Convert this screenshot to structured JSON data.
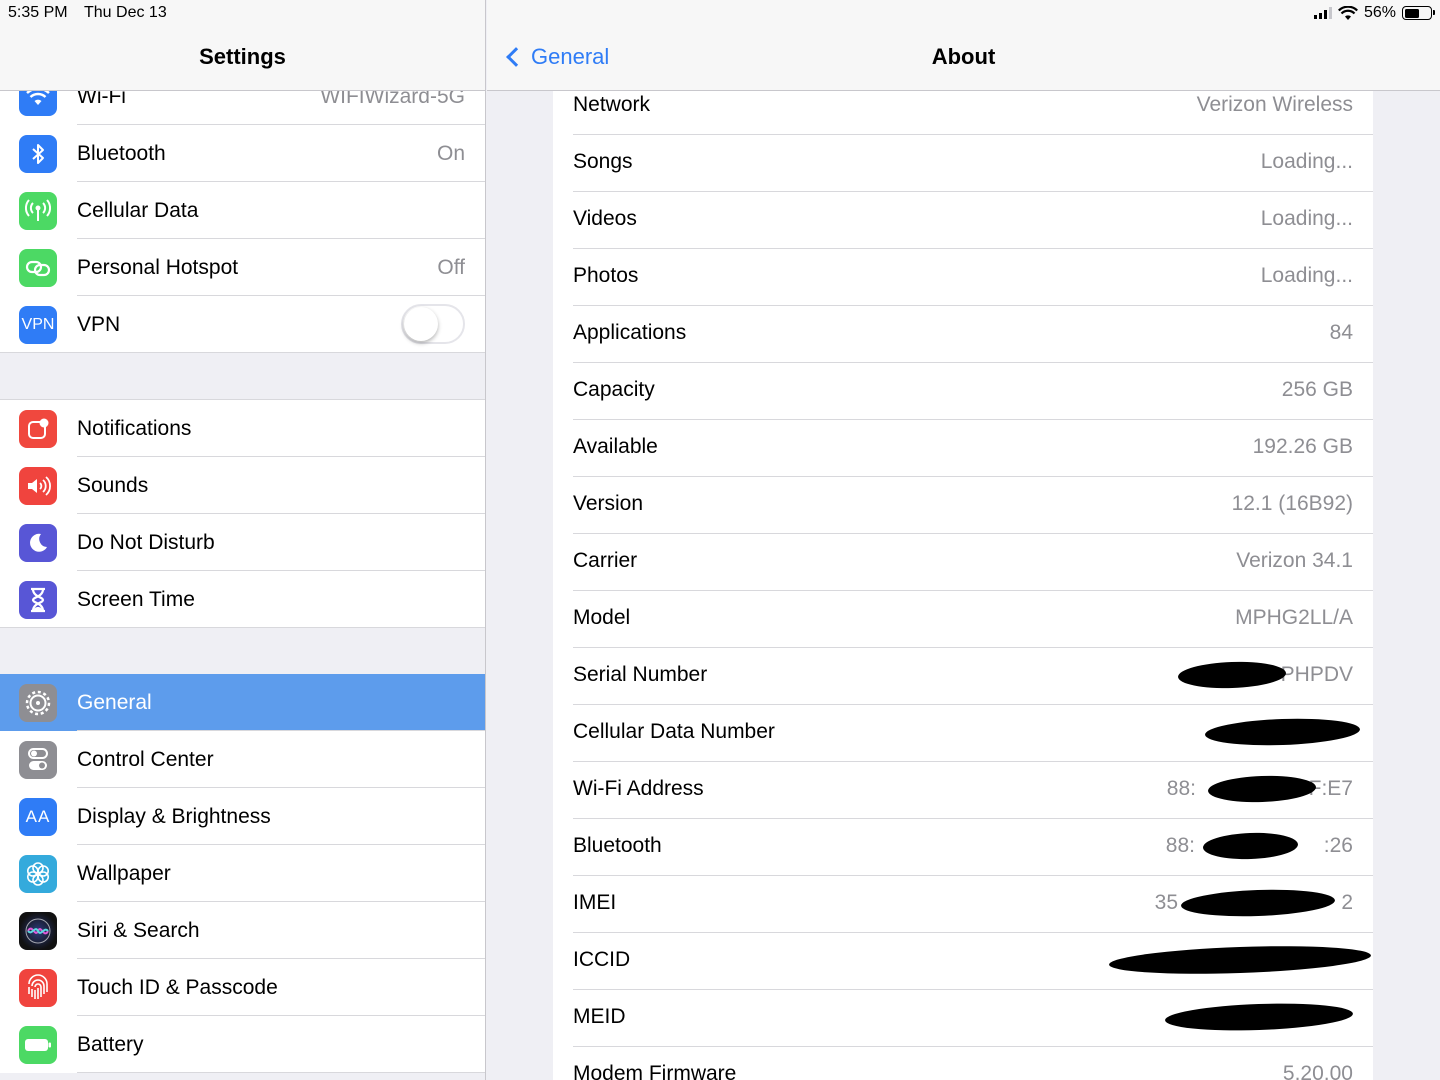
{
  "status": {
    "time": "5:35 PM",
    "date": "Thu Dec 13",
    "battery": "56%"
  },
  "master": {
    "title": "Settings",
    "groups": [
      [
        {
          "label": "Wi-Fi",
          "value": "WIFIWizard-5G",
          "icon": "wifi-icon",
          "color": "#2f7cf6"
        },
        {
          "label": "Bluetooth",
          "value": "On",
          "icon": "bluetooth-icon",
          "color": "#2f7cf6"
        },
        {
          "label": "Cellular Data",
          "value": "",
          "icon": "antenna-icon",
          "color": "#4cd964"
        },
        {
          "label": "Personal Hotspot",
          "value": "Off",
          "icon": "link-icon",
          "color": "#4cd964"
        },
        {
          "label": "VPN",
          "value": "",
          "icon": "vpn-icon",
          "color": "#2f7cf6",
          "icon_text": "VPN",
          "toggle": false
        }
      ],
      [
        {
          "label": "Notifications",
          "icon": "notifications-icon",
          "color": "#f0483e"
        },
        {
          "label": "Sounds",
          "icon": "speaker-icon",
          "color": "#f0443e"
        },
        {
          "label": "Do Not Disturb",
          "icon": "moon-icon",
          "color": "#5856d6"
        },
        {
          "label": "Screen Time",
          "icon": "hourglass-icon",
          "color": "#5856d6"
        }
      ],
      [
        {
          "label": "General",
          "icon": "gear-icon",
          "color": "#8e8e93",
          "selected": true
        },
        {
          "label": "Control Center",
          "icon": "toggles-icon",
          "color": "#8e8e93"
        },
        {
          "label": "Display & Brightness",
          "icon": "text-size-icon",
          "color": "#2f7cf6",
          "icon_text": "AA"
        },
        {
          "label": "Wallpaper",
          "icon": "flower-icon",
          "color": "#34aadc"
        },
        {
          "label": "Siri & Search",
          "icon": "siri-icon",
          "color": "#1c1c3c"
        },
        {
          "label": "Touch ID & Passcode",
          "icon": "fingerprint-icon",
          "color": "#f0443e"
        },
        {
          "label": "Battery",
          "icon": "battery-icon",
          "color": "#4cd964"
        }
      ]
    ]
  },
  "detail": {
    "back_label": "General",
    "title": "About",
    "rows": [
      {
        "label": "Network",
        "value": "Verizon Wireless"
      },
      {
        "label": "Songs",
        "value": "Loading..."
      },
      {
        "label": "Videos",
        "value": "Loading..."
      },
      {
        "label": "Photos",
        "value": "Loading..."
      },
      {
        "label": "Applications",
        "value": "84"
      },
      {
        "label": "Capacity",
        "value": "256 GB"
      },
      {
        "label": "Available",
        "value": "192.26 GB"
      },
      {
        "label": "Version",
        "value": "12.1 (16B92)"
      },
      {
        "label": "Carrier",
        "value": "Verizon 34.1"
      },
      {
        "label": "Model",
        "value": "MPHG2LL/A"
      },
      {
        "label": "Serial Number",
        "value": "PHPDV",
        "redacted": true
      },
      {
        "label": "Cellular Data Number",
        "value": "",
        "redacted": true
      },
      {
        "label": "Wi-Fi Address",
        "value": "88:",
        "value2": "F:E7",
        "redacted": true
      },
      {
        "label": "Bluetooth",
        "value": "88:",
        "value2": ":26",
        "redacted": true
      },
      {
        "label": "IMEI",
        "value": "35",
        "value2": "2",
        "redacted": true
      },
      {
        "label": "ICCID",
        "value": "",
        "redacted": true
      },
      {
        "label": "MEID",
        "value": "",
        "redacted": true
      },
      {
        "label": "Modem Firmware",
        "value": "5.20.00"
      }
    ]
  }
}
